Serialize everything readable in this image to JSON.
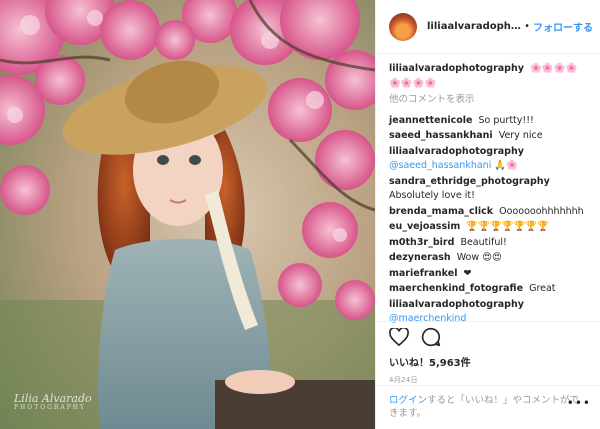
{
  "post": {
    "watermark_name": "Lilia Alvarado",
    "watermark_sub": "PHOTOGRAPHY"
  },
  "header": {
    "username": "liliaalvaradophotog...",
    "separator": "•",
    "follow_label": "フォローする"
  },
  "caption": {
    "username": "liliaalvaradophotography",
    "text": "🌸🌸🌸🌸🌸🌸🌸🌸"
  },
  "load_more_label": "他のコメントを表示",
  "comments": [
    {
      "user": "jeannettenicole",
      "text": "So purtty!!!",
      "mention": ""
    },
    {
      "user": "saeed_hassankhani",
      "text": "Very nice",
      "mention": ""
    },
    {
      "user": "liliaalvaradophotography",
      "mention": "@saeed_hassankhani",
      "text": "🙏🌸"
    },
    {
      "user": "sandra_ethridge_photography",
      "text": "Absolutely love it!",
      "mention": ""
    },
    {
      "user": "brenda_mama_click",
      "text": "Ooooooohhhhhhh",
      "mention": ""
    },
    {
      "user": "eu_vejoassim",
      "text": "🏆🏆🏆🏆🏆🏆🏆",
      "mention": ""
    },
    {
      "user": "m0th3r_bird",
      "text": "Beautiful!",
      "mention": ""
    },
    {
      "user": "dezynerash",
      "text": "Wow 😍😍",
      "mention": ""
    },
    {
      "user": "mariefrankel",
      "text": "❤",
      "mention": ""
    },
    {
      "user": "maerchenkind_fotografie",
      "text": "Great",
      "mention": ""
    },
    {
      "user": "liliaalvaradophotography",
      "mention": "@maerchenkind",
      "text": ""
    }
  ],
  "actions": {
    "likes": "いいね！5,963件",
    "date": "4月24日"
  },
  "footer": {
    "login_label": "ログイン",
    "text": "すると「いいね！」やコメントができます。",
    "menu_dots": "•••"
  },
  "icons": [
    "heart-icon",
    "comment-icon",
    "more-options-icon"
  ]
}
